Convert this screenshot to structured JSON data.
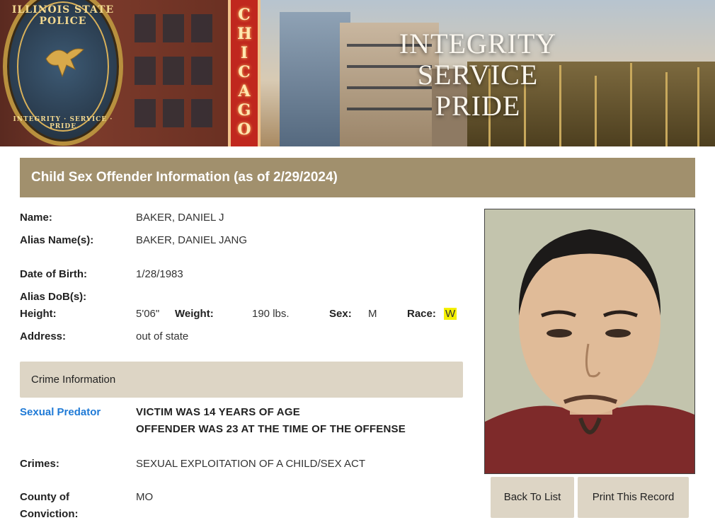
{
  "banner": {
    "badge_top_text": "ILLINOIS STATE POLICE",
    "badge_bottom_text": "INTEGRITY · SERVICE · PRIDE",
    "theater_sign": "CHICAGO",
    "motto_line1": "INTEGRITY",
    "motto_line2": "SERVICE",
    "motto_line3": "PRIDE"
  },
  "title": "Child Sex Offender Information (as of 2/29/2024)",
  "offender": {
    "name_label": "Name:",
    "name": "BAKER, DANIEL J",
    "alias_label": "Alias Name(s):",
    "alias": "BAKER, DANIEL JANG",
    "dob_label": "Date of Birth:",
    "dob": "1/28/1983",
    "alias_dob_label": "Alias DoB(s):",
    "height_label": "Height:",
    "height": "5'06\"",
    "weight_label": "Weight:",
    "weight": "190 lbs.",
    "sex_label": "Sex:",
    "sex": "M",
    "race_label": "Race:",
    "race": "W",
    "address_label": "Address:",
    "address": "out of state"
  },
  "crime": {
    "section_title": "Crime Information",
    "predator_link": "Sexual Predator",
    "victim_age": "VICTIM WAS 14 YEARS OF AGE",
    "offender_age": "OFFENDER WAS 23 AT THE TIME OF THE OFFENSE",
    "crimes_label": "Crimes:",
    "crimes": "SEXUAL EXPLOITATION OF A CHILD/SEX ACT",
    "county_label_line1": "County of",
    "county_label_line2": "Conviction:",
    "county": "MO"
  },
  "buttons": {
    "back": "Back To List",
    "print": "Print This Record"
  },
  "colors": {
    "title_bar": "#a1906d",
    "section_bar": "#ddd5c5",
    "link": "#1f7ad6",
    "highlight": "#f4f000"
  }
}
